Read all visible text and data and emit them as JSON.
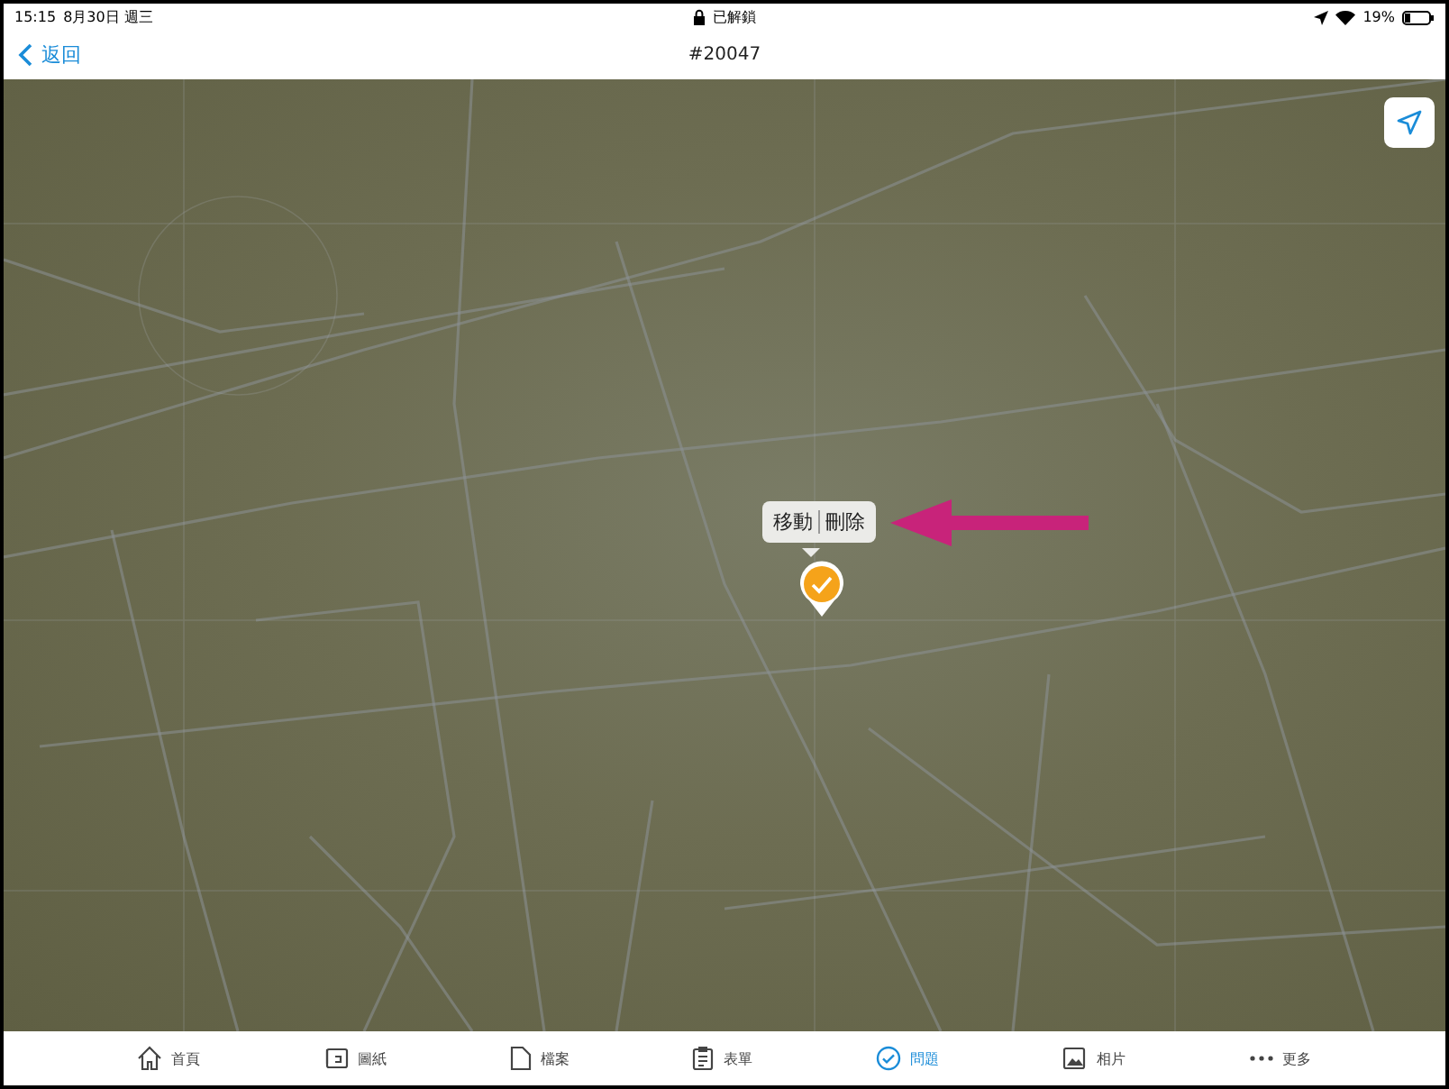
{
  "status_bar": {
    "time": "15:15",
    "date": "8月30日 週三",
    "lock_text": "已解鎖",
    "battery": "19%"
  },
  "nav_bar": {
    "back": "返回",
    "title": "#20047"
  },
  "map": {
    "popup": [
      "移動",
      "刪除"
    ]
  },
  "tab_bar": [
    {
      "label": "首頁",
      "kind": "home",
      "selected": false
    },
    {
      "label": "圖紙",
      "kind": "drawing",
      "selected": false
    },
    {
      "label": "檔案",
      "kind": "file",
      "selected": false
    },
    {
      "label": "表單",
      "kind": "form",
      "selected": false
    },
    {
      "label": "問題",
      "kind": "issue",
      "selected": true
    },
    {
      "label": "相片",
      "kind": "photo",
      "selected": false
    },
    {
      "label": "更多",
      "kind": "more",
      "selected": false
    }
  ]
}
